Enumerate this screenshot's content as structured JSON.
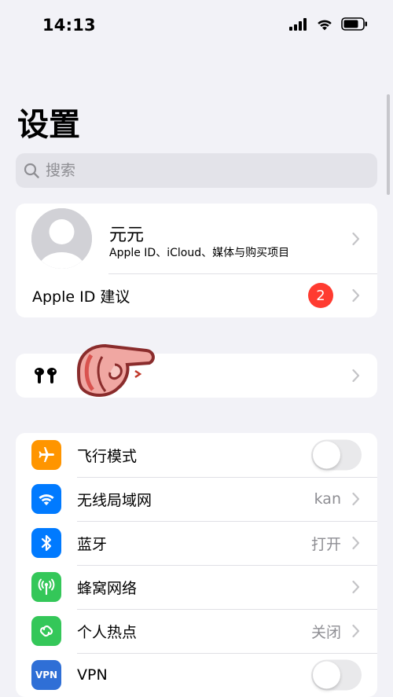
{
  "status_bar": {
    "time": "14:13"
  },
  "page_title": "设置",
  "search": {
    "placeholder": "搜索"
  },
  "profile": {
    "name": "元元",
    "subtitle": "Apple ID、iCloud、媒体与购买项目",
    "suggestion_label": "Apple ID 建议",
    "suggestion_badge": "2"
  },
  "airpods_row": {
    "icon": "airpods-icon"
  },
  "settings": [
    {
      "label": "飞行模式",
      "value": "",
      "icon": "airplane-icon",
      "color": "#ff9500",
      "type": "toggle",
      "on": false
    },
    {
      "label": "无线局域网",
      "value": "kan",
      "icon": "wifi-icon",
      "color": "#007aff",
      "type": "link"
    },
    {
      "label": "蓝牙",
      "value": "打开",
      "icon": "bluetooth-icon",
      "color": "#007aff",
      "type": "link"
    },
    {
      "label": "蜂窝网络",
      "value": "",
      "icon": "cellular-icon",
      "color": "#34c759",
      "type": "link"
    },
    {
      "label": "个人热点",
      "value": "关闭",
      "icon": "hotspot-icon",
      "color": "#34c759",
      "type": "link"
    },
    {
      "label": "VPN",
      "value": "",
      "icon": "vpn-icon",
      "icon_text": "VPN",
      "color": "#2f6fd6",
      "type": "toggle",
      "on": false
    }
  ]
}
